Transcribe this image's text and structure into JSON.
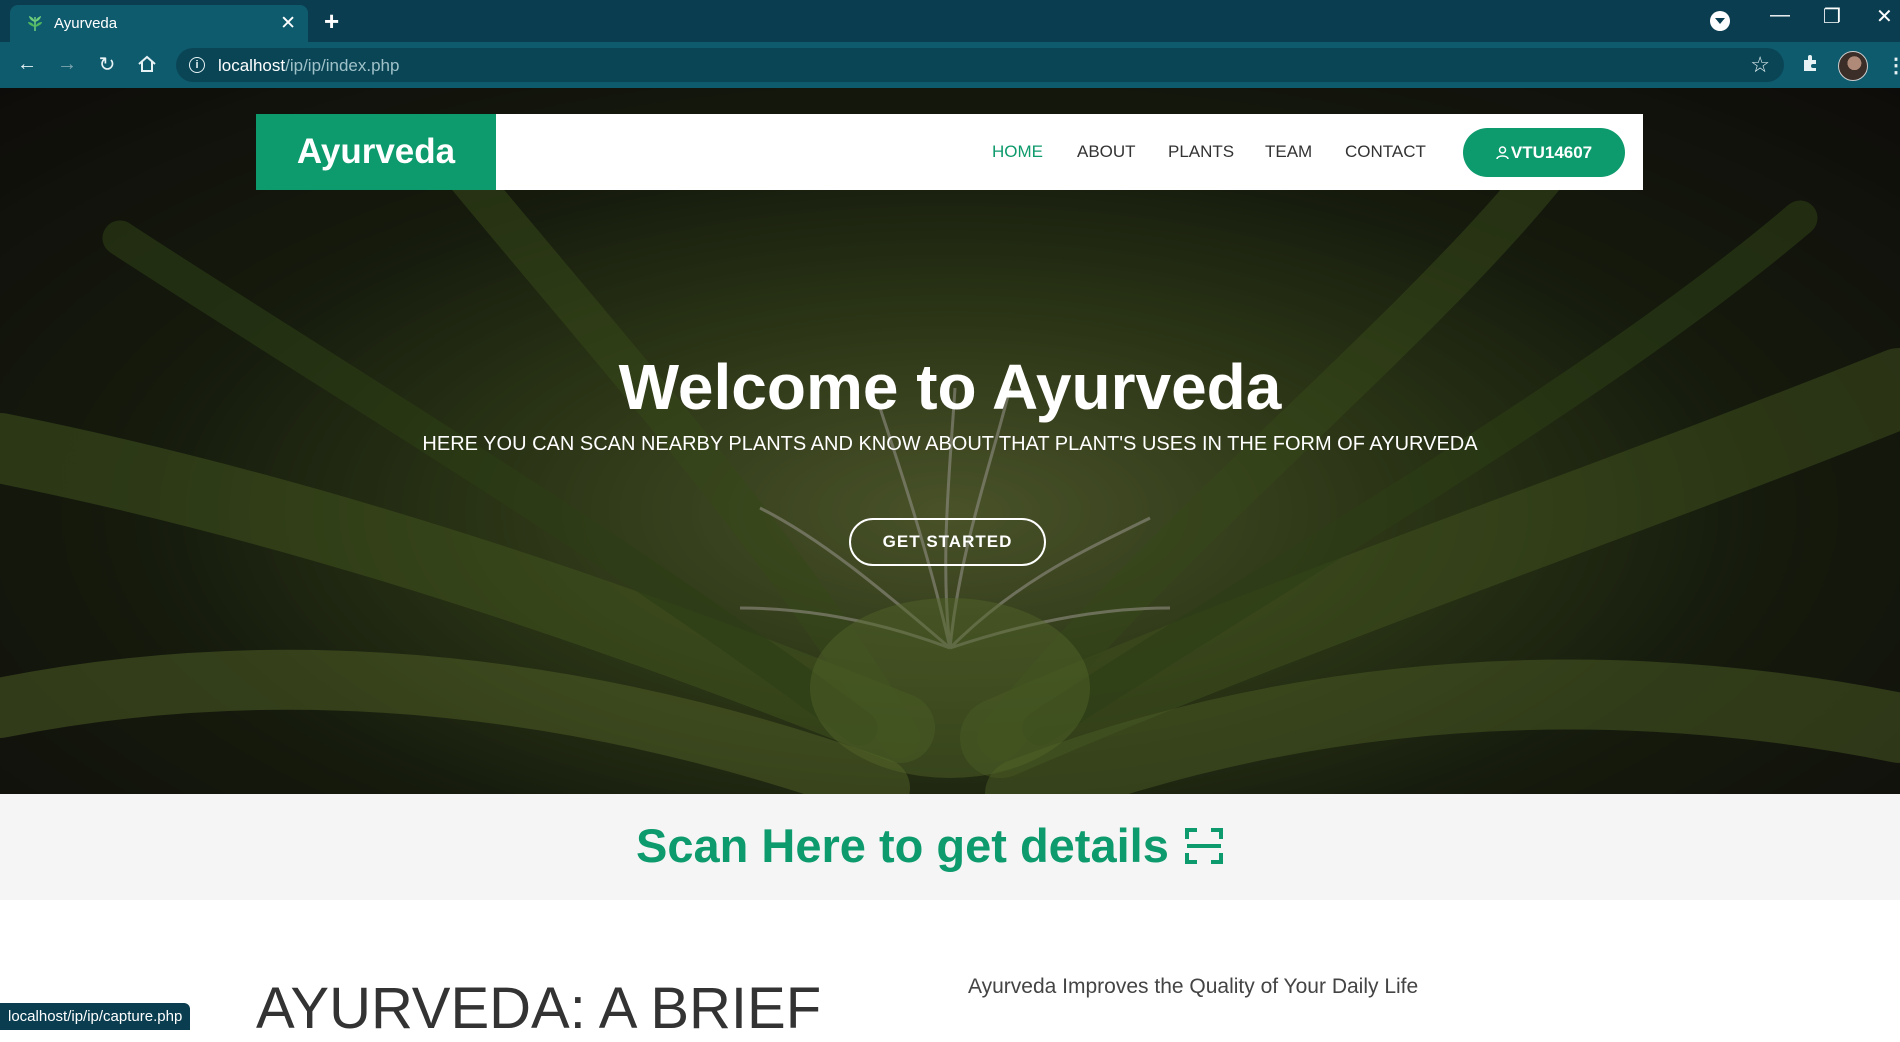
{
  "browser": {
    "tab_title": "Ayurveda",
    "new_tab": "+",
    "url_host": "localhost",
    "url_path": "/ip/ip/index.php",
    "status_url": "localhost/ip/ip/capture.php"
  },
  "site": {
    "logo": "Ayurveda",
    "nav": [
      "HOME",
      "ABOUT",
      "PLANTS",
      "TEAM",
      "CONTACT"
    ],
    "active_nav": "HOME",
    "user_label": "VTU14607"
  },
  "hero": {
    "title": "Welcome to Ayurveda",
    "subtitle": "HERE YOU CAN SCAN NEARBY PLANTS AND KNOW ABOUT THAT PLANT'S USES IN THE FORM OF AYURVEDA",
    "cta": "GET STARTED"
  },
  "scan": {
    "label": "Scan Here to get details",
    "icon": "scan-icon"
  },
  "about": {
    "title": "AYURVEDA: A BRIEF",
    "quote": "Ayurveda Improves the Quality of Your Daily Life"
  },
  "colors": {
    "brand": "#0d9a6c",
    "chrome": "#0f5b6e"
  }
}
